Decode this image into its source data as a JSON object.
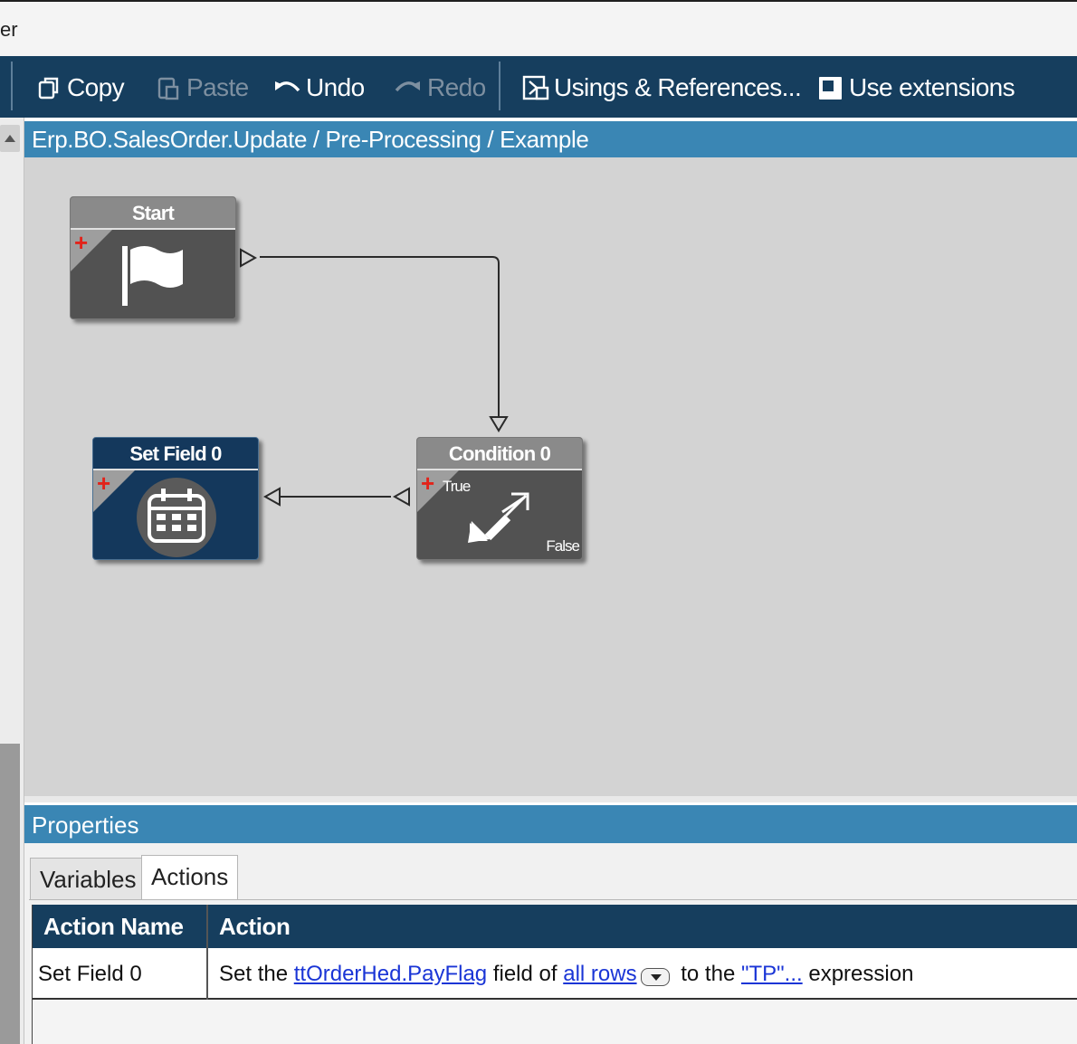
{
  "window": {
    "title_fragment": "er"
  },
  "toolbar": {
    "copy": "Copy",
    "paste": "Paste",
    "undo": "Undo",
    "redo": "Redo",
    "usings": "Usings & References...",
    "extensions": "Use extensions"
  },
  "breadcrumb": "Erp.BO.SalesOrder.Update / Pre-Processing / Example",
  "workflow": {
    "start": {
      "label": "Start",
      "icon": "flag-icon"
    },
    "condition": {
      "label": "Condition 0",
      "true_label": "True",
      "false_label": "False",
      "icon": "condition-arrows-icon"
    },
    "setfield": {
      "label": "Set Field 0",
      "icon": "calendar-icon"
    }
  },
  "properties": {
    "title": "Properties",
    "tabs": {
      "variables": "Variables",
      "actions": "Actions"
    },
    "active_tab": "Actions",
    "columns": {
      "action_name": "Action Name",
      "action": "Action"
    },
    "rows": [
      {
        "name": "Set Field 0",
        "text1": "Set the",
        "field_link": "ttOrderHed.PayFlag",
        "text2": "field of",
        "rows_link": "all rows",
        "text3": "to the",
        "expr_link": "\"TP\"...",
        "text4": "expression"
      }
    ]
  },
  "colors": {
    "toolbar": "#163e5e",
    "header_blue": "#3a86b4",
    "node_gray": "#525252",
    "node_blue": "#14385c",
    "link": "#1a35d6"
  }
}
